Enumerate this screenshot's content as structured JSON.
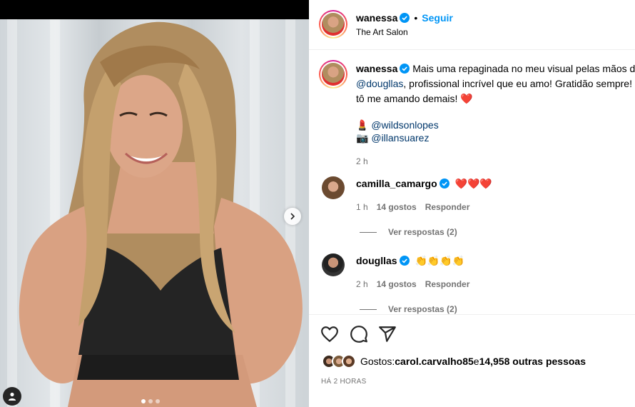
{
  "post": {
    "author": "wanessa",
    "follow_label": "Seguir",
    "separator": "•",
    "location": "The Art Salon"
  },
  "caption": {
    "author": "wanessa",
    "line1": "Mais uma repaginada no meu visual pelas mãos do",
    "mention1": "@dougllas",
    "line2": ", profissional incrível que eu amo! Gratidão sempre! E",
    "line3": "tô me amando demais! ",
    "heart": "❤️",
    "credit1_icon": "💄",
    "credit1": "@wildsonlopes",
    "credit2_icon": "📷",
    "credit2": "@illansuarez",
    "time": "2 h"
  },
  "comments": [
    {
      "user": "camilla_camargo",
      "text": "❤️❤️❤️",
      "time": "1 h",
      "likes": "14 gostos",
      "reply": "Responder",
      "view_replies": "Ver respostas (2)"
    },
    {
      "user": "dougllas",
      "text": "👏👏👏👏",
      "time": "2 h",
      "likes": "14 gostos",
      "reply": "Responder",
      "view_replies": "Ver respostas (2)"
    }
  ],
  "likes": {
    "prefix": "Gostos: ",
    "user": "carol.carvalho85",
    "middle": " e ",
    "others": "14,958 outras pessoas"
  },
  "timestamp": "HÁ 2 HORAS",
  "colors": {
    "link": "#0095f6",
    "mention": "#00376b",
    "muted": "#737373",
    "verified": "#0095f6"
  },
  "icons": {
    "like": "heart-icon",
    "comment": "comment-icon",
    "share": "share-icon",
    "next": "chevron-right-icon",
    "tags": "user-tag-icon"
  }
}
